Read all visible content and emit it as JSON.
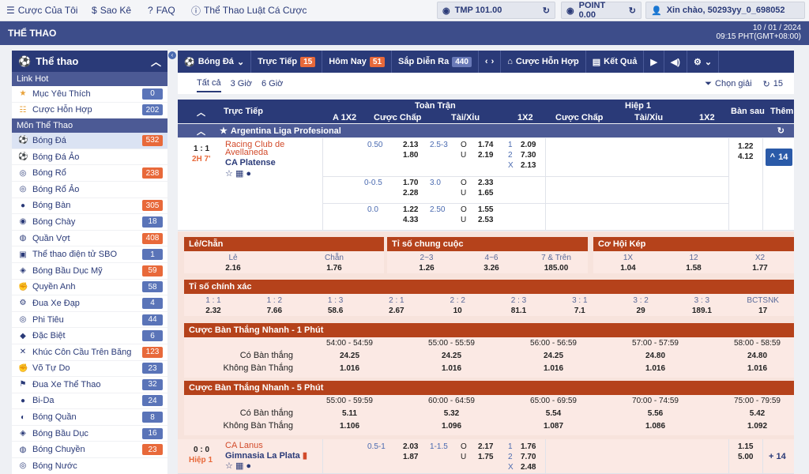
{
  "topbar": {
    "my_bets": "Cược Của Tôi",
    "statement": "Sao Kê",
    "faq": "FAQ",
    "rules": "Thể Thao Luật Cá Cược",
    "tmp": "TMP 101.00",
    "point": "POINT 0.00",
    "greeting": "Xin chào, 50293yy_0_698052"
  },
  "header": {
    "title": "THỂ THAO",
    "date": "10 / 01 / 2024",
    "time": "09:15 PHT(GMT+08:00)"
  },
  "sidebar": {
    "title": "Thể thao",
    "link_hot": "Link Hot",
    "mon": "Môn Thể Thao",
    "hot": [
      {
        "label": "Mục Yêu Thích",
        "count": "0"
      },
      {
        "label": "Cược Hỗn Hợp",
        "count": "202"
      }
    ],
    "sports": [
      {
        "label": "Bóng Đá",
        "count": "532",
        "icon": "⚽"
      },
      {
        "label": "Bóng Đá Ảo",
        "count": "",
        "icon": "⚽"
      },
      {
        "label": "Bóng Rổ",
        "count": "238",
        "icon": "◎"
      },
      {
        "label": "Bóng Rổ Ảo",
        "count": "",
        "icon": "◎"
      },
      {
        "label": "Bóng Bàn",
        "count": "305",
        "icon": "●"
      },
      {
        "label": "Bóng Chày",
        "count": "18",
        "icon": "◉"
      },
      {
        "label": "Quần Vợt",
        "count": "408",
        "icon": "◍"
      },
      {
        "label": "Thể thao điện tử SBO",
        "count": "1",
        "icon": "▣"
      },
      {
        "label": "Bóng Bầu Dục Mỹ",
        "count": "59",
        "icon": "◈"
      },
      {
        "label": "Quyền Anh",
        "count": "58",
        "icon": "✊"
      },
      {
        "label": "Đua Xe Đạp",
        "count": "4",
        "icon": "⚙"
      },
      {
        "label": "Phi Tiêu",
        "count": "44",
        "icon": "◎"
      },
      {
        "label": "Đặc Biệt",
        "count": "6",
        "icon": "◆"
      },
      {
        "label": "Khúc Côn Cầu Trên Băng",
        "count": "123",
        "icon": "✕"
      },
      {
        "label": "Võ Tự Do",
        "count": "23",
        "icon": "✊"
      },
      {
        "label": "Đua Xe Thể Thao",
        "count": "32",
        "icon": "⚑"
      },
      {
        "label": "Bi-Da",
        "count": "24",
        "icon": "●"
      },
      {
        "label": "Bóng Quần",
        "count": "8",
        "icon": "◐"
      },
      {
        "label": "Bóng Bầu Dục",
        "count": "16",
        "icon": "◈"
      },
      {
        "label": "Bóng Chuyền",
        "count": "23",
        "icon": "◍"
      },
      {
        "label": "Bóng Nước",
        "count": "",
        "icon": "◎"
      }
    ]
  },
  "tabs": {
    "sport": "Bóng Đá",
    "live": "Trực Tiếp",
    "live_n": "15",
    "today": "Hôm Nay",
    "today_n": "51",
    "soon": "Sắp Diễn Ra",
    "soon_n": "440",
    "mix": "Cược Hỗn Hợp",
    "results": "Kết Quả"
  },
  "subtabs": {
    "all": "Tất cả",
    "h3": "3 Giờ",
    "h6": "6 Giờ",
    "filter": "Chọn giải",
    "refresh": "15"
  },
  "table": {
    "live": "Trực Tiếp",
    "full": "Toàn Trận",
    "half": "Hiệp 1",
    "a1x2": "A 1X2",
    "hdp": "Cược Chấp",
    "ou": "Tài/Xỉu",
    "x12": "1X2",
    "ht_hdp": "Cược Chấp",
    "ht_ou": "Tài/Xỉu",
    "ht_1x2": "1X2",
    "corner": "Bàn sau",
    "more": "Thêm"
  },
  "league": "Argentina Liga Profesional",
  "match1": {
    "score": "1 : 1",
    "time": "2H 7'",
    "home": "Racing Club de Avellaneda",
    "away": "CA Platense",
    "more": "14",
    "lines": [
      {
        "hdp": "0.50",
        "h1": "2.13",
        "h2": "1.80",
        "ou": "2.5-3",
        "o": "1.74",
        "u": "2.19",
        "x1": "2.09",
        "x2": "7.30",
        "xx": "2.13",
        "c1": "1.22",
        "c2": "4.12"
      },
      {
        "hdp": "0-0.5",
        "h1": "1.70",
        "h2": "2.28",
        "ou": "3.0",
        "o": "2.33",
        "u": "1.65"
      },
      {
        "hdp": "0.0",
        "h1": "1.22",
        "h2": "4.33",
        "ou": "2.50",
        "o": "1.55",
        "u": "2.53"
      }
    ]
  },
  "oe": {
    "title": "Lẻ/Chẵn",
    "odd": "Lẻ",
    "even": "Chẵn",
    "v1": "2.16",
    "v2": "1.76"
  },
  "tg": {
    "title": "Tỉ số chung cuộc",
    "l1": "2~3",
    "l2": "4~6",
    "l3": "7 & Trên",
    "v1": "1.26",
    "v2": "3.26",
    "v3": "185.00"
  },
  "dc": {
    "title": "Cơ Hội Kép",
    "l1": "1X",
    "l2": "12",
    "l3": "X2",
    "v1": "1.04",
    "v2": "1.58",
    "v3": "1.77"
  },
  "cs": {
    "title": "Tỉ số chính xác",
    "labels": [
      "1 : 1",
      "1 : 2",
      "1 : 3",
      "2 : 1",
      "2 : 2",
      "2 : 3",
      "3 : 1",
      "3 : 2",
      "3 : 3",
      "BCTSNK"
    ],
    "values": [
      "2.32",
      "7.66",
      "58.6",
      "2.67",
      "10",
      "81.1",
      "7.1",
      "29",
      "189.1",
      "17"
    ]
  },
  "fg1": {
    "title": "Cược Bàn Thắng Nhanh - 1 Phút",
    "cols": [
      "54:00 - 54:59",
      "55:00 - 55:59",
      "56:00 - 56:59",
      "57:00 - 57:59",
      "58:00 - 58:59"
    ],
    "yes": "Có Bàn thắng",
    "no": "Không Bàn Thắng",
    "yv": [
      "24.25",
      "24.25",
      "24.25",
      "24.80",
      "24.80"
    ],
    "nv": [
      "1.016",
      "1.016",
      "1.016",
      "1.016",
      "1.016"
    ]
  },
  "fg5": {
    "title": "Cược Bàn Thắng Nhanh - 5 Phút",
    "cols": [
      "55:00 - 59:59",
      "60:00 - 64:59",
      "65:00 - 69:59",
      "70:00 - 74:59",
      "75:00 - 79:59"
    ],
    "yes": "Có Bàn thắng",
    "no": "Không Bàn Thắng",
    "yv": [
      "5.11",
      "5.32",
      "5.54",
      "5.56",
      "5.42"
    ],
    "nv": [
      "1.106",
      "1.096",
      "1.087",
      "1.086",
      "1.092"
    ]
  },
  "match2": {
    "score": "0 : 0",
    "time": "Hiệp 1",
    "home": "CA Lanus",
    "away": "Gimnasia La Plata",
    "more": "14",
    "hdp": "0.5-1",
    "h1": "2.03",
    "h2": "1.87",
    "ou": "1-1.5",
    "o": "2.17",
    "u": "1.75",
    "x1": "1.76",
    "x2": "7.70",
    "xx": "2.48",
    "c1": "1.15",
    "c2": "5.00"
  }
}
